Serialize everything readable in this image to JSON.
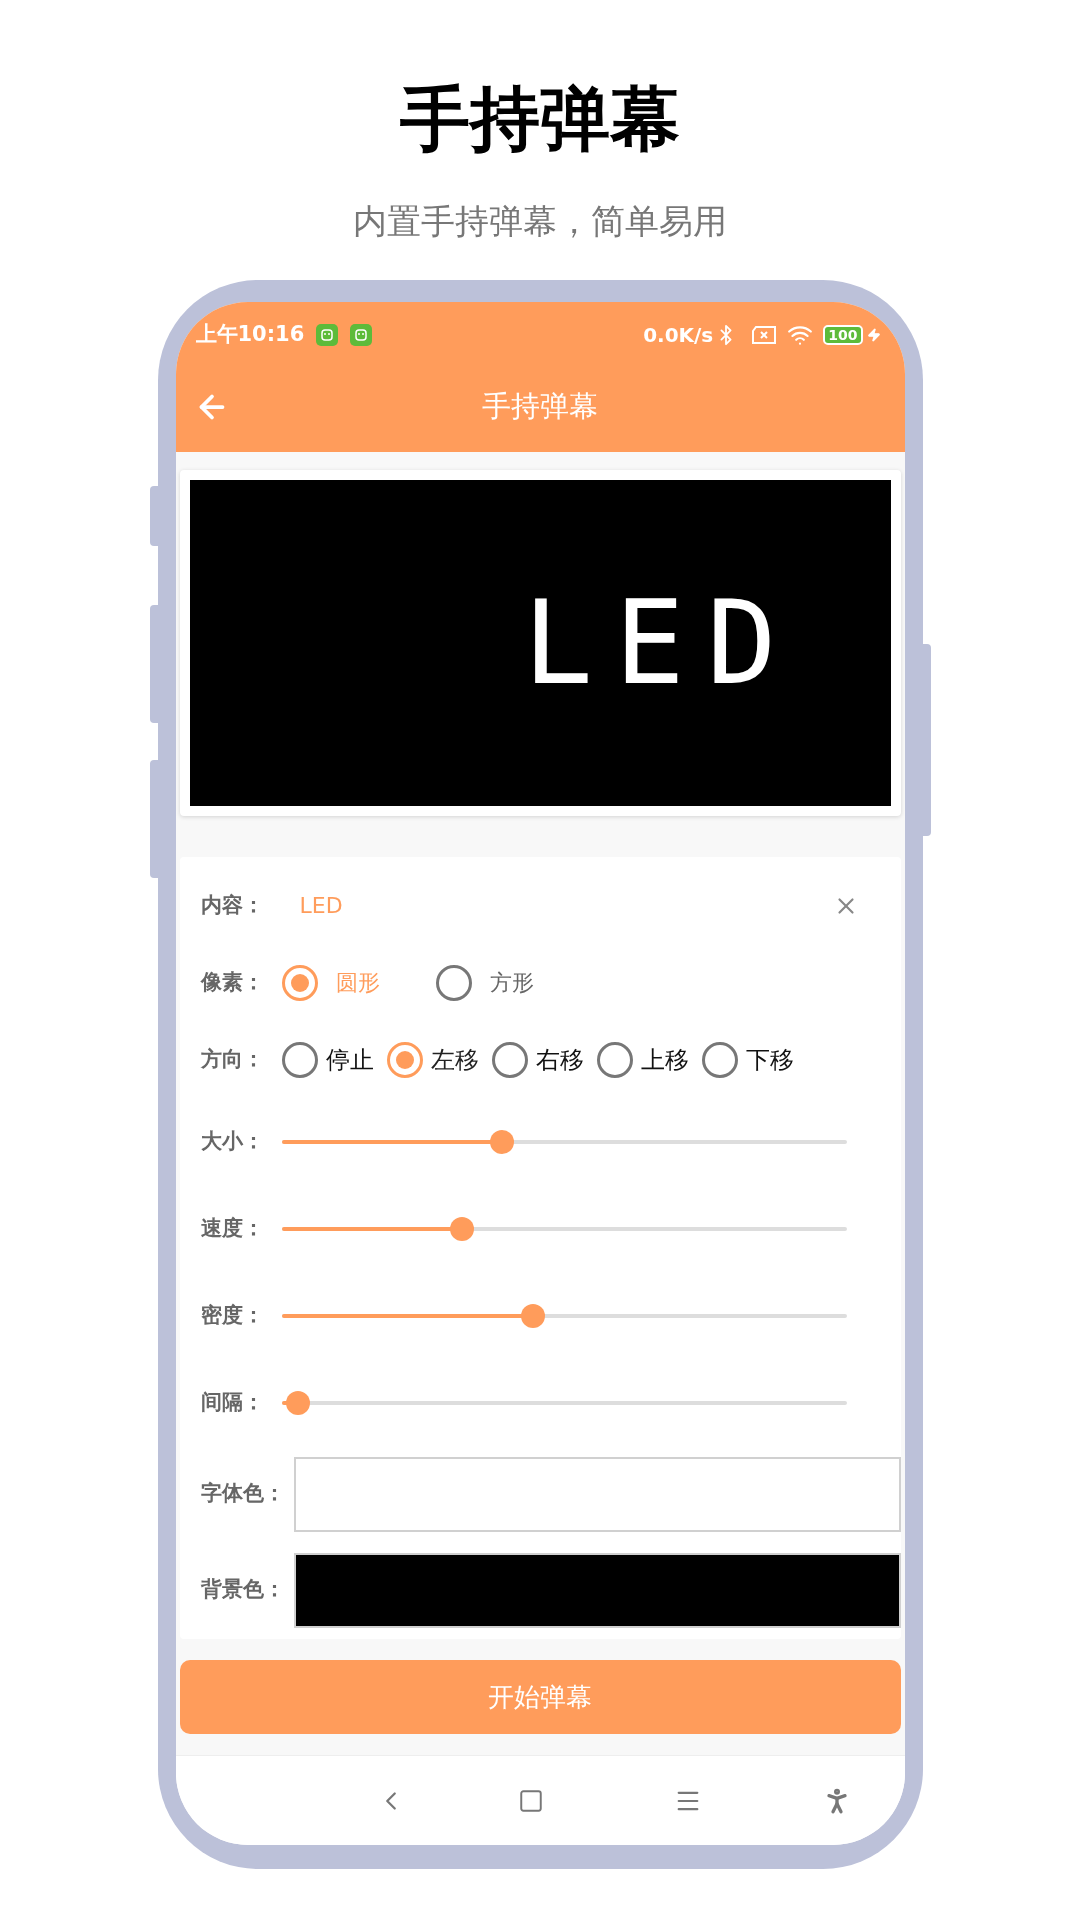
{
  "hero": {
    "title": "手持弹幕",
    "subtitle": "内置手持弹幕，简单易用"
  },
  "status_bar": {
    "time": "上午10:16",
    "net_speed": "0.0K/s",
    "battery": "100"
  },
  "app_bar": {
    "title": "手持弹幕"
  },
  "preview": {
    "text": "LED"
  },
  "form": {
    "content": {
      "label": "内容：",
      "value": "LED"
    },
    "pixel": {
      "label": "像素：",
      "options": [
        {
          "label": "圆形",
          "selected": true
        },
        {
          "label": "方形",
          "selected": false
        }
      ]
    },
    "direction": {
      "label": "方向：",
      "options": [
        {
          "label": "停止",
          "selected": false
        },
        {
          "label": "左移",
          "selected": true
        },
        {
          "label": "右移",
          "selected": false
        },
        {
          "label": "上移",
          "selected": false
        },
        {
          "label": "下移",
          "selected": false
        }
      ]
    },
    "sliders": [
      {
        "label": "大小：",
        "level": 0.39
      },
      {
        "label": "速度：",
        "level": 0.32
      },
      {
        "label": "密度：",
        "level": 0.445
      },
      {
        "label": "间隔：",
        "level": 0.03
      }
    ],
    "colors": [
      {
        "label": "字体色：",
        "color": "#ffffff"
      },
      {
        "label": "背景色：",
        "color": "#000000"
      }
    ]
  },
  "start_button": "开始弹幕"
}
